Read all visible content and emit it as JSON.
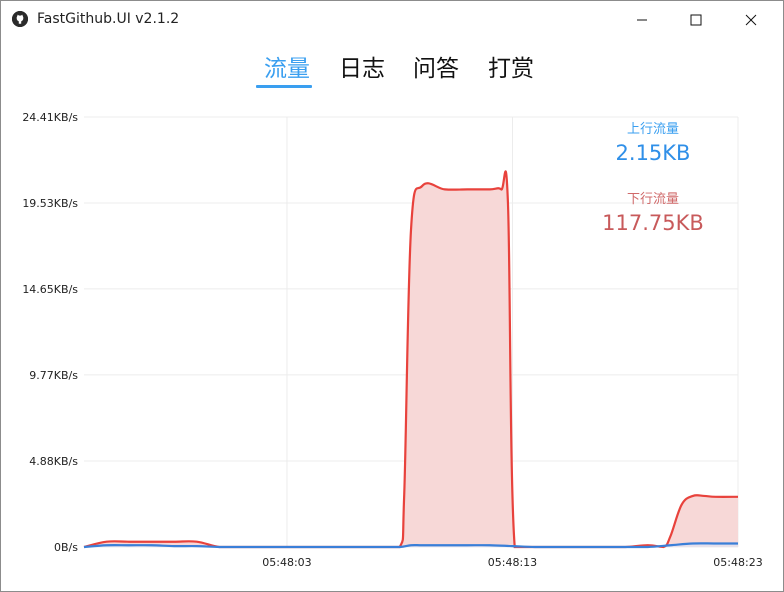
{
  "window": {
    "title": "FastGithub.UI v2.1.2",
    "icon": "github-icon"
  },
  "tabs": [
    {
      "label": "流量",
      "active": true
    },
    {
      "label": "日志",
      "active": false
    },
    {
      "label": "问答",
      "active": false
    },
    {
      "label": "打赏",
      "active": false
    }
  ],
  "legend": {
    "upload_label": "上行流量",
    "upload_value": "2.15KB",
    "download_label": "下行流量",
    "download_value": "117.75KB"
  },
  "colors": {
    "accent": "#3a9ff0",
    "upload_line": "#3a7fd8",
    "download_line": "#e8423c",
    "download_fill": "#f7d8d7"
  },
  "chart_data": {
    "type": "area",
    "y_tick_labels": [
      "0B/s",
      "4.88KB/s",
      "9.77KB/s",
      "14.65KB/s",
      "19.53KB/s",
      "24.41KB/s"
    ],
    "y_tick_values": [
      0,
      4.88,
      9.77,
      14.65,
      19.53,
      24.41
    ],
    "x_tick_labels": [
      "05:48:03",
      "05:48:13",
      "05:48:23"
    ],
    "x_tick_values": [
      9,
      19,
      29
    ],
    "ylim": [
      0,
      24.41
    ],
    "xlim": [
      0,
      29
    ],
    "grid": true,
    "series": [
      {
        "name": "下行流量",
        "x": [
          0,
          1,
          2,
          3,
          4,
          5,
          6,
          7,
          8,
          9,
          10,
          11,
          12,
          13,
          14,
          14.2,
          14.5,
          15,
          16,
          17,
          18,
          18.5,
          18.8,
          19.1,
          20,
          21,
          22,
          23,
          24,
          25,
          25.7,
          26,
          26.5,
          27,
          27.5,
          28,
          29
        ],
        "values": [
          0,
          0.3,
          0.3,
          0.3,
          0.3,
          0.3,
          0,
          0,
          0,
          0,
          0,
          0,
          0,
          0,
          0,
          3.0,
          18.0,
          20.5,
          20.3,
          20.3,
          20.3,
          20.3,
          19.5,
          0,
          0,
          0,
          0,
          0,
          0,
          0.1,
          0,
          0.6,
          2.4,
          2.9,
          2.9,
          2.85,
          2.85
        ]
      },
      {
        "name": "上行流量",
        "x": [
          0,
          1,
          2,
          3,
          4,
          5,
          6,
          7,
          8,
          9,
          10,
          11,
          12,
          13,
          14,
          14.5,
          15,
          16,
          17,
          18,
          19,
          20,
          21,
          22,
          23,
          24,
          25,
          26,
          27,
          28,
          29
        ],
        "values": [
          0,
          0.1,
          0.1,
          0.1,
          0.05,
          0.05,
          0,
          0,
          0,
          0,
          0,
          0,
          0,
          0,
          0,
          0.1,
          0.1,
          0.1,
          0.1,
          0.1,
          0.05,
          0,
          0,
          0,
          0,
          0,
          0,
          0.1,
          0.2,
          0.2,
          0.2
        ]
      }
    ]
  }
}
